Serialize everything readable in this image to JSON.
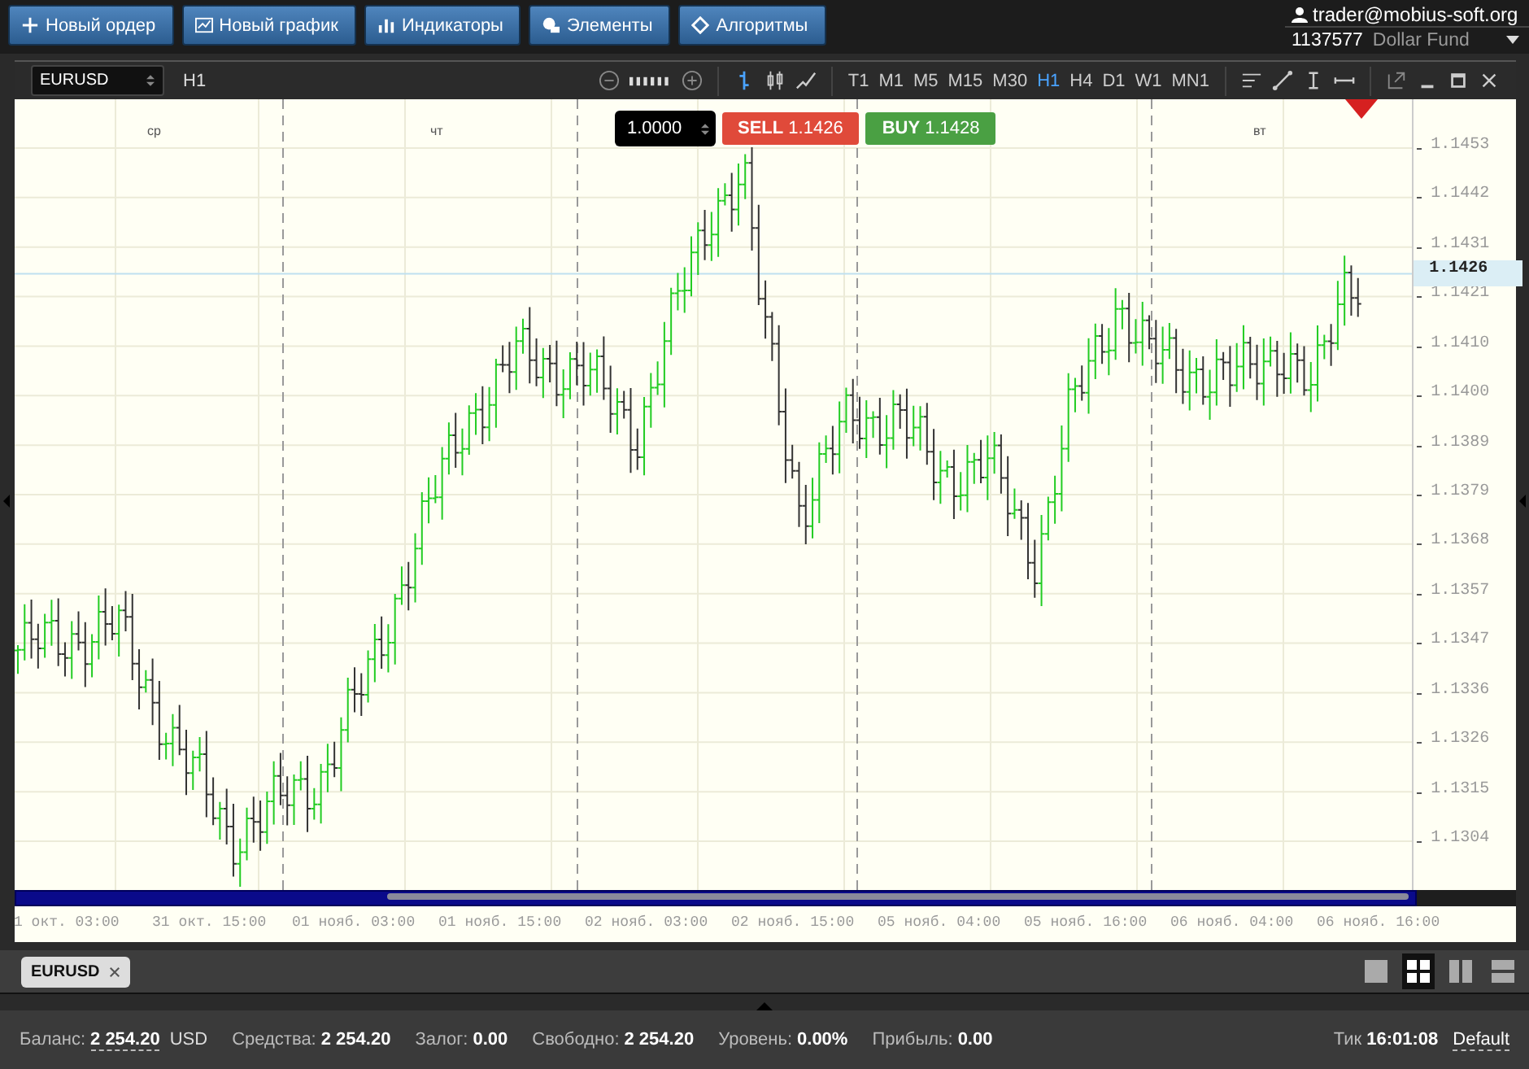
{
  "toolbar": {
    "buttons": [
      {
        "label": "Новый ордер"
      },
      {
        "label": "Новый график"
      },
      {
        "label": "Индикаторы"
      },
      {
        "label": "Элементы"
      },
      {
        "label": "Алгоритмы"
      }
    ]
  },
  "account": {
    "user": "trader@mobius-soft.org",
    "number": "1137577",
    "name": "Dollar Fund"
  },
  "chart_window": {
    "symbol": "EURUSD",
    "period": "H1",
    "chart_types": [
      {
        "kind": "bars",
        "selected": true
      },
      {
        "kind": "candles",
        "selected": false
      },
      {
        "kind": "line",
        "selected": false
      }
    ],
    "timeframes": [
      {
        "label": "T1",
        "selected": false
      },
      {
        "label": "M1",
        "selected": false
      },
      {
        "label": "M5",
        "selected": false
      },
      {
        "label": "M15",
        "selected": false
      },
      {
        "label": "M30",
        "selected": false
      },
      {
        "label": "H1",
        "selected": true
      },
      {
        "label": "H4",
        "selected": false
      },
      {
        "label": "D1",
        "selected": false
      },
      {
        "label": "W1",
        "selected": false
      },
      {
        "label": "MN1",
        "selected": false
      }
    ],
    "order_panel": {
      "lot": "1.0000",
      "sell_label": "SELL",
      "sell_price": "1.1426",
      "buy_label": "BUY",
      "buy_price": "1.1428"
    },
    "day_labels": [
      "ср",
      "чт",
      "вт"
    ],
    "price_axis": [
      "1.1453",
      "1.1442",
      "1.1431",
      "1.1421",
      "1.1410",
      "1.1400",
      "1.1389",
      "1.1379",
      "1.1368",
      "1.1357",
      "1.1347",
      "1.1336",
      "1.1326",
      "1.1315",
      "1.1304"
    ],
    "current_price": "1.1426",
    "time_axis": [
      "1 окт. 03:00",
      "31 окт. 15:00",
      "01 нояб. 03:00",
      "01 нояб. 15:00",
      "02 нояб. 03:00",
      "02 нояб. 15:00",
      "05 нояб. 04:00",
      "05 нояб. 16:00",
      "06 нояб. 04:00",
      "06 нояб. 16:00"
    ]
  },
  "tabs": [
    {
      "label": "EURUSD",
      "selected": true
    }
  ],
  "layouts": [
    {
      "kind": "single",
      "selected": false
    },
    {
      "kind": "grid",
      "selected": true
    },
    {
      "kind": "columns",
      "selected": false
    },
    {
      "kind": "rows",
      "selected": false
    }
  ],
  "status": {
    "balance_label": "Баланс:",
    "balance": "2 254.20",
    "currency": "USD",
    "items": [
      {
        "label": "Средства:",
        "value": "2 254.20"
      },
      {
        "label": "Залог:",
        "value": "0.00"
      },
      {
        "label": "Свободно:",
        "value": "2 254.20"
      },
      {
        "label": "Уровень:",
        "value": "0.00%"
      },
      {
        "label": "Прибыль:",
        "value": "0.00"
      }
    ],
    "tick_label": "Тик",
    "tick": "16:01:08",
    "profile": "Default"
  }
}
